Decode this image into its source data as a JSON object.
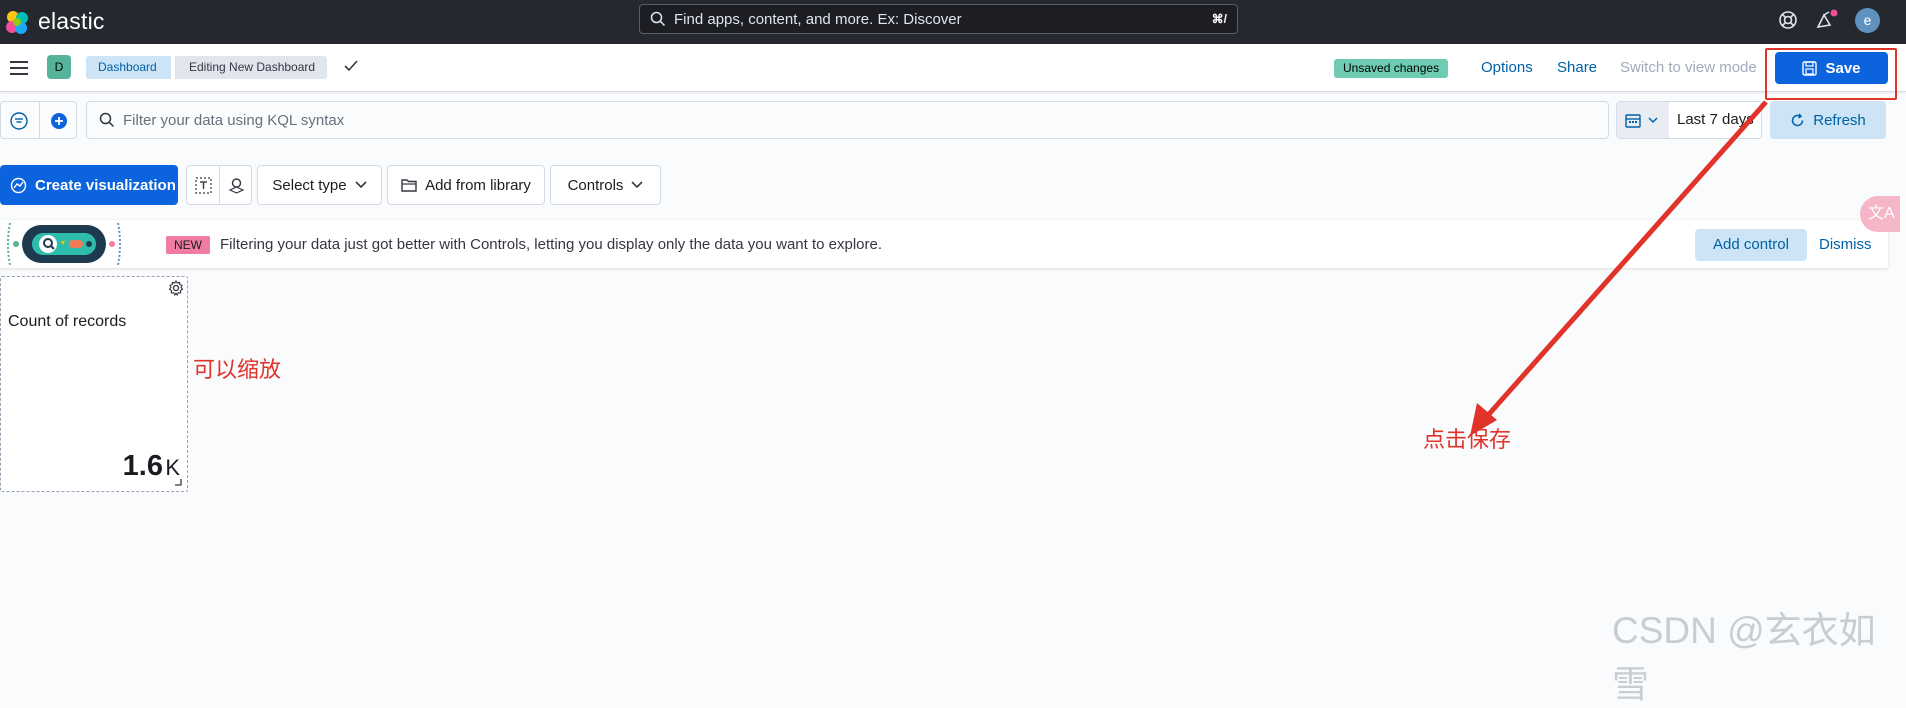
{
  "header": {
    "brand": "elastic",
    "search_placeholder": "Find apps, content, and more. Ex: Discover",
    "search_shortcut": "⌘/",
    "avatar_initial": "e"
  },
  "nav": {
    "space_initial": "D",
    "breadcrumbs": [
      "Dashboard",
      "Editing New Dashboard"
    ],
    "unsaved_badge": "Unsaved changes",
    "options": "Options",
    "share": "Share",
    "switch_view": "Switch to view mode",
    "save": "Save"
  },
  "filter": {
    "kql_placeholder": "Filter your data using KQL syntax",
    "date_range": "Last 7 days",
    "refresh": "Refresh"
  },
  "toolbar": {
    "create_visualization": "Create visualization",
    "select_type": "Select type",
    "add_from_library": "Add from library",
    "controls": "Controls"
  },
  "callout": {
    "badge": "NEW",
    "text": "Filtering your data just got better with Controls, letting you display only the data you want to explore.",
    "add_control": "Add control",
    "dismiss": "Dismiss"
  },
  "panel": {
    "title": "Count of records",
    "value": "1.6",
    "unit": "K"
  },
  "annotations": {
    "zoom_note": "可以缩放",
    "save_note": "点击保存",
    "watermark": "CSDN @玄衣如雪",
    "translate_glyph": "文A",
    "color": "#e0332a"
  }
}
